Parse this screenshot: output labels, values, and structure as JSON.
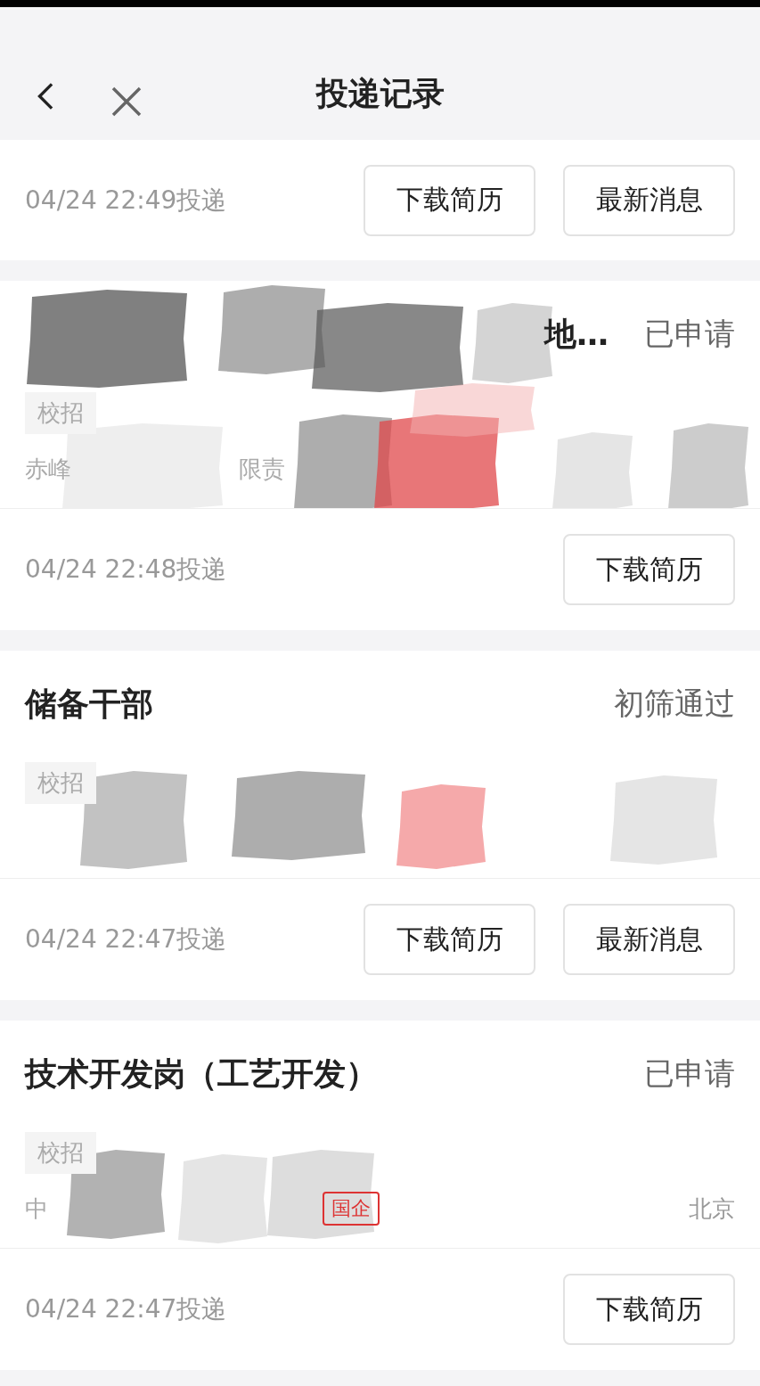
{
  "header": {
    "title": "投递记录"
  },
  "top_record": {
    "time": "04/24 22:49投递",
    "buttons": [
      "下载简历",
      "最新消息"
    ]
  },
  "records": [
    {
      "title": "地…",
      "status": "已申请",
      "tag": "校招",
      "company": "赤峰",
      "company_tail": "限责",
      "redacted": true,
      "time": "04/24 22:48投递",
      "buttons": [
        "下载简历"
      ]
    },
    {
      "title": "储备干部",
      "status": "初筛通过",
      "tag": "校招",
      "redacted": true,
      "time": "04/24 22:47投递",
      "buttons": [
        "下载简历",
        "最新消息"
      ]
    },
    {
      "title": "技术开发岗（工艺开发）",
      "status": "已申请",
      "tag": "校招",
      "company": "中",
      "badge": "国企",
      "location": "北京",
      "redacted": true,
      "time": "04/24 22:47投递",
      "buttons": [
        "下载简历"
      ]
    }
  ]
}
